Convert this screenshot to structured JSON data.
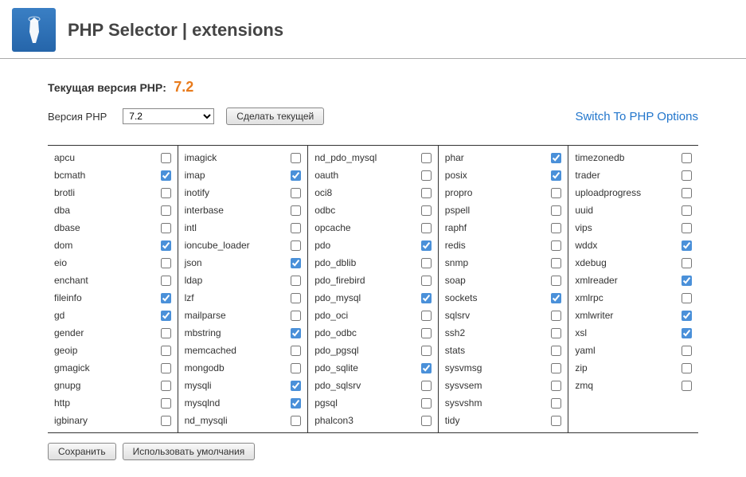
{
  "header": {
    "title": "PHP Selector | extensions"
  },
  "current": {
    "label": "Текущая версия PHP:",
    "value": "7.2"
  },
  "control": {
    "label": "Версия PHP",
    "selected": "7.2",
    "button": "Сделать текущей",
    "options_link": "Switch To PHP Options"
  },
  "columns": [
    [
      {
        "name": "apcu",
        "checked": false
      },
      {
        "name": "bcmath",
        "checked": true
      },
      {
        "name": "brotli",
        "checked": false
      },
      {
        "name": "dba",
        "checked": false
      },
      {
        "name": "dbase",
        "checked": false
      },
      {
        "name": "dom",
        "checked": true
      },
      {
        "name": "eio",
        "checked": false
      },
      {
        "name": "enchant",
        "checked": false
      },
      {
        "name": "fileinfo",
        "checked": true
      },
      {
        "name": "gd",
        "checked": true
      },
      {
        "name": "gender",
        "checked": false
      },
      {
        "name": "geoip",
        "checked": false
      },
      {
        "name": "gmagick",
        "checked": false
      },
      {
        "name": "gnupg",
        "checked": false
      },
      {
        "name": "http",
        "checked": false
      },
      {
        "name": "igbinary",
        "checked": false
      }
    ],
    [
      {
        "name": "imagick",
        "checked": false
      },
      {
        "name": "imap",
        "checked": true
      },
      {
        "name": "inotify",
        "checked": false
      },
      {
        "name": "interbase",
        "checked": false
      },
      {
        "name": "intl",
        "checked": false
      },
      {
        "name": "ioncube_loader",
        "checked": false
      },
      {
        "name": "json",
        "checked": true
      },
      {
        "name": "ldap",
        "checked": false
      },
      {
        "name": "lzf",
        "checked": false
      },
      {
        "name": "mailparse",
        "checked": false
      },
      {
        "name": "mbstring",
        "checked": true
      },
      {
        "name": "memcached",
        "checked": false
      },
      {
        "name": "mongodb",
        "checked": false
      },
      {
        "name": "mysqli",
        "checked": true
      },
      {
        "name": "mysqlnd",
        "checked": true
      },
      {
        "name": "nd_mysqli",
        "checked": false
      }
    ],
    [
      {
        "name": "nd_pdo_mysql",
        "checked": false
      },
      {
        "name": "oauth",
        "checked": false
      },
      {
        "name": "oci8",
        "checked": false
      },
      {
        "name": "odbc",
        "checked": false
      },
      {
        "name": "opcache",
        "checked": false
      },
      {
        "name": "pdo",
        "checked": true
      },
      {
        "name": "pdo_dblib",
        "checked": false
      },
      {
        "name": "pdo_firebird",
        "checked": false
      },
      {
        "name": "pdo_mysql",
        "checked": true
      },
      {
        "name": "pdo_oci",
        "checked": false
      },
      {
        "name": "pdo_odbc",
        "checked": false
      },
      {
        "name": "pdo_pgsql",
        "checked": false
      },
      {
        "name": "pdo_sqlite",
        "checked": true
      },
      {
        "name": "pdo_sqlsrv",
        "checked": false
      },
      {
        "name": "pgsql",
        "checked": false
      },
      {
        "name": "phalcon3",
        "checked": false
      }
    ],
    [
      {
        "name": "phar",
        "checked": true
      },
      {
        "name": "posix",
        "checked": true
      },
      {
        "name": "propro",
        "checked": false
      },
      {
        "name": "pspell",
        "checked": false
      },
      {
        "name": "raphf",
        "checked": false
      },
      {
        "name": "redis",
        "checked": false
      },
      {
        "name": "snmp",
        "checked": false
      },
      {
        "name": "soap",
        "checked": false
      },
      {
        "name": "sockets",
        "checked": true
      },
      {
        "name": "sqlsrv",
        "checked": false
      },
      {
        "name": "ssh2",
        "checked": false
      },
      {
        "name": "stats",
        "checked": false
      },
      {
        "name": "sysvmsg",
        "checked": false
      },
      {
        "name": "sysvsem",
        "checked": false
      },
      {
        "name": "sysvshm",
        "checked": false
      },
      {
        "name": "tidy",
        "checked": false
      }
    ],
    [
      {
        "name": "timezonedb",
        "checked": false
      },
      {
        "name": "trader",
        "checked": false
      },
      {
        "name": "uploadprogress",
        "checked": false
      },
      {
        "name": "uuid",
        "checked": false
      },
      {
        "name": "vips",
        "checked": false
      },
      {
        "name": "wddx",
        "checked": true
      },
      {
        "name": "xdebug",
        "checked": false
      },
      {
        "name": "xmlreader",
        "checked": true
      },
      {
        "name": "xmlrpc",
        "checked": false
      },
      {
        "name": "xmlwriter",
        "checked": true
      },
      {
        "name": "xsl",
        "checked": true
      },
      {
        "name": "yaml",
        "checked": false
      },
      {
        "name": "zip",
        "checked": false
      },
      {
        "name": "zmq",
        "checked": false
      }
    ]
  ],
  "footer": {
    "save": "Сохранить",
    "reset": "Использовать умолчания"
  }
}
